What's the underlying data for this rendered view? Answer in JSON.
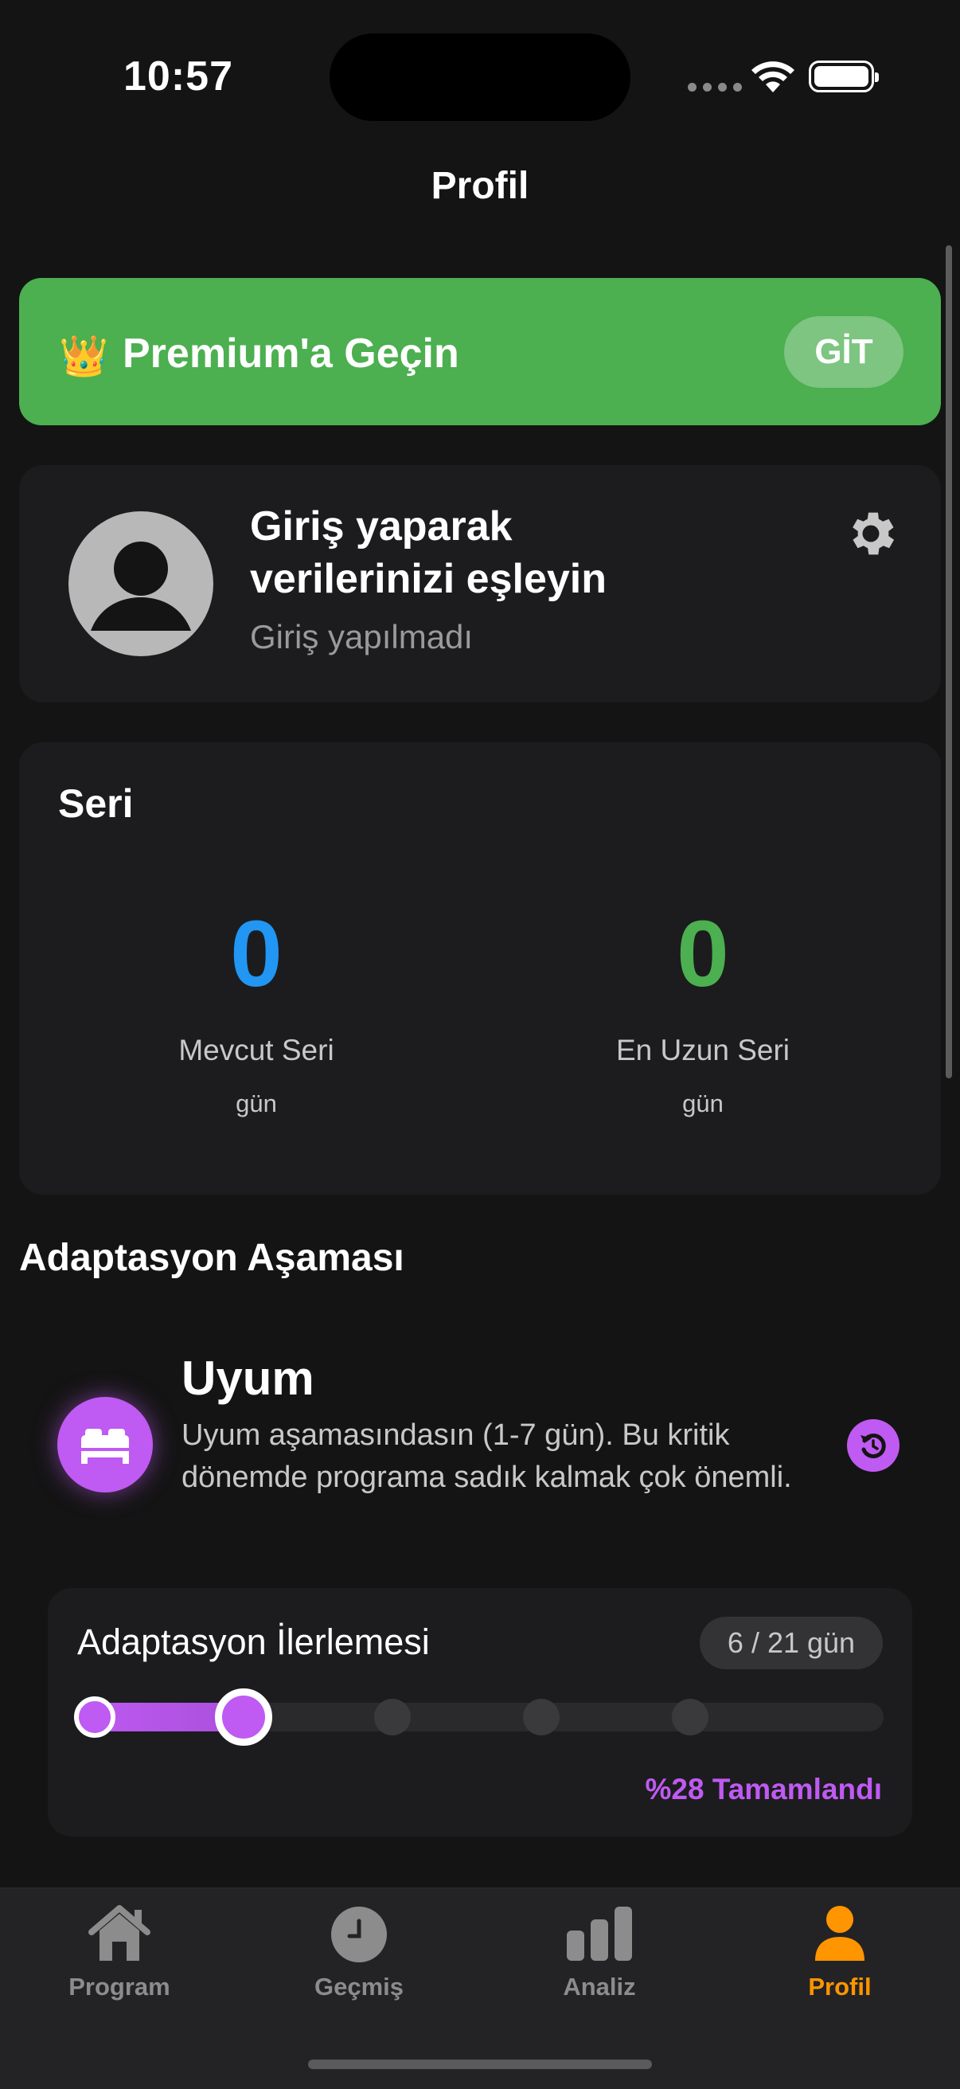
{
  "status_bar": {
    "time": "10:57"
  },
  "header": {
    "title": "Profil"
  },
  "premium": {
    "icon": "crown-icon",
    "label": "Premium'a Geçin",
    "button_label": "GİT",
    "color": "#4CAF50"
  },
  "profile": {
    "title": "Giriş yaparak verilerinizi eşleyin",
    "subtitle": "Giriş yapılmadı"
  },
  "streak": {
    "title": "Seri",
    "current": {
      "value": "0",
      "label": "Mevcut Seri",
      "unit": "gün",
      "color": "#2196F3"
    },
    "longest": {
      "value": "0",
      "label": "En Uzun Seri",
      "unit": "gün",
      "color": "#4CAF50"
    }
  },
  "adaptation": {
    "section_title": "Adaptasyon Aşaması",
    "phase_name": "Uyum",
    "phase_description": "Uyum aşamasındasın (1-7 gün). Bu kritik dönemde programa sadık kalmak çok önemli.",
    "progress_label": "Adaptasyon İlerlemesi",
    "progress_badge": "6 / 21 gün",
    "progress_fraction": 0.28,
    "percent_text": "%28 Tamamlandı",
    "accent_color": "#BF5AF2"
  },
  "tabs": [
    {
      "label": "Program",
      "icon": "home-icon",
      "active": false
    },
    {
      "label": "Geçmiş",
      "icon": "clock-icon",
      "active": false
    },
    {
      "label": "Analiz",
      "icon": "bar-chart-icon",
      "active": false
    },
    {
      "label": "Profil",
      "icon": "person-icon",
      "active": true
    }
  ]
}
